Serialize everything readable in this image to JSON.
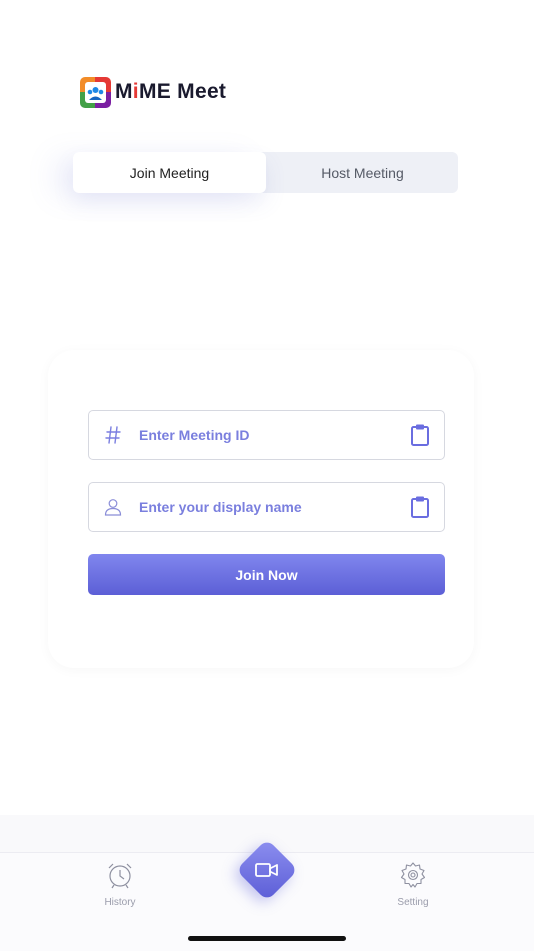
{
  "app": {
    "name_part1": "M",
    "name_part2": "i",
    "name_part3": "ME Meet"
  },
  "segment": {
    "join_label": "Join Meeting",
    "host_label": "Host Meeting",
    "active": "join"
  },
  "form": {
    "meeting_id": {
      "placeholder": "Enter Meeting ID",
      "value": "",
      "icon": "hash-icon",
      "action_icon": "clipboard-icon"
    },
    "display_name": {
      "placeholder": "Enter your display name",
      "value": "",
      "icon": "user-icon",
      "action_icon": "clipboard-icon"
    },
    "submit_label": "Join Now"
  },
  "tabbar": {
    "history_label": "History",
    "history_icon": "alarm-clock-icon",
    "center_icon": "video-camera-icon",
    "setting_label": "Setting",
    "setting_icon": "gear-icon"
  },
  "colors": {
    "accent": "#6a6de0",
    "accent_dark": "#5c5fd6",
    "text_muted": "#9a9cab"
  }
}
